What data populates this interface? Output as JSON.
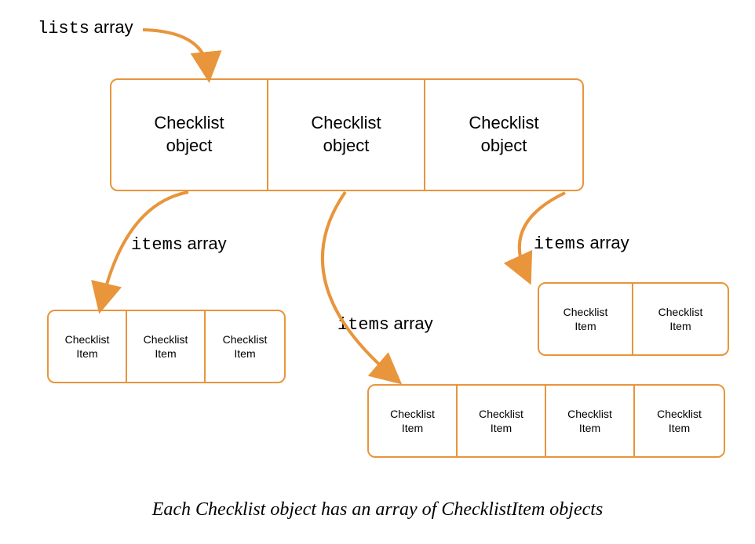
{
  "labels": {
    "lists_mono": "lists",
    "lists_word": "array",
    "items_mono": "items",
    "items_word": "array"
  },
  "cells": {
    "checklist_object": "Checklist object",
    "checklist_item": "Checklist Item"
  },
  "arrays": {
    "lists_count": 3,
    "items": [
      3,
      4,
      2
    ]
  },
  "caption": "Each Checklist object has an array of ChecklistItem objects",
  "colors": {
    "stroke": "#E8953C"
  }
}
